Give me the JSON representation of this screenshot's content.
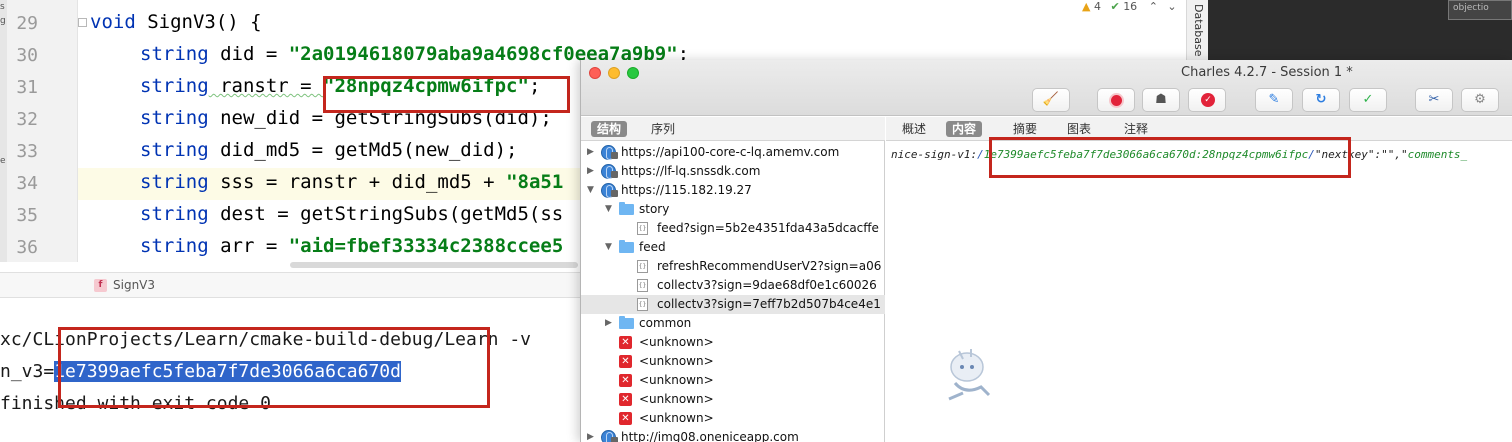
{
  "ide": {
    "edge_glyphs": [
      "s",
      "g",
      "e"
    ],
    "line_numbers": [
      "29",
      "30",
      "31",
      "32",
      "33",
      "34",
      "35",
      "36"
    ],
    "code": [
      {
        "kw": "void",
        "rest": " SignV3() {",
        "str": "",
        "tail": ""
      },
      {
        "kw": "string",
        "rest": " did = ",
        "str": "\"2a0194618079aba9a4698cf0eea7a9b9\"",
        "tail": ";"
      },
      {
        "kw": "string",
        "rest": " ranstr = ",
        "str": "\"28npqz4cpmw6ifpc\"",
        "tail": ";"
      },
      {
        "kw": "string",
        "rest": " new_did = getStringSubs(did);",
        "str": "",
        "tail": ""
      },
      {
        "kw": "string",
        "rest": " did_md5 = getMd5(new_did);",
        "str": "",
        "tail": ""
      },
      {
        "kw": "string",
        "rest": " sss = ranstr + did_md5 + ",
        "str": "\"8a51",
        "tail": ""
      },
      {
        "kw": "string",
        "rest": " dest = getStringSubs(getMd5(ss",
        "str": "",
        "tail": ""
      },
      {
        "kw": "string",
        "rest": " arr = ",
        "str": "\"aid=fbef33334c2388ccee5",
        "tail": ""
      }
    ],
    "inspections": {
      "warnings": "4",
      "checks": "16"
    },
    "database_tab": "Database",
    "dark_thumb_text": "objectio",
    "breadcrumb": {
      "badge": "f",
      "label": "SignV3"
    },
    "terminal": {
      "line1": "xc/CLionProjects/Learn/cmake-build-debug/Learn -v",
      "line2_prefix": "n_v3=",
      "line2_selected": "1e7399aefc5feba7f7de3066a6ca670d",
      "line3": "finished with exit code 0"
    }
  },
  "charles": {
    "title": "Charles 4.2.7 - Session 1 *",
    "left_tabs": [
      "结构",
      "序列"
    ],
    "right_tabs": [
      "概述",
      "内容",
      "摘要",
      "图表",
      "注释"
    ],
    "tree": [
      {
        "indent": 0,
        "arrow": "▶",
        "type": "globe",
        "label": "https://api100-core-c-lq.amemv.com"
      },
      {
        "indent": 0,
        "arrow": "▶",
        "type": "globe",
        "label": "https://lf-lq.snssdk.com"
      },
      {
        "indent": 0,
        "arrow": "▼",
        "type": "globe",
        "label": "https://115.182.19.27"
      },
      {
        "indent": 1,
        "arrow": "▼",
        "type": "folder",
        "label": "story"
      },
      {
        "indent": 2,
        "arrow": "",
        "type": "doc",
        "label": "feed?sign=5b2e4351fda43a5dcacffe"
      },
      {
        "indent": 1,
        "arrow": "▼",
        "type": "folder",
        "label": "feed"
      },
      {
        "indent": 2,
        "arrow": "",
        "type": "doc",
        "label": "refreshRecommendUserV2?sign=a06"
      },
      {
        "indent": 2,
        "arrow": "",
        "type": "doc",
        "label": "collectv3?sign=9dae68df0e1c60026"
      },
      {
        "indent": 2,
        "arrow": "",
        "type": "doc",
        "label": "collectv3?sign=7eff7b2d507b4ce4e1"
      },
      {
        "indent": 1,
        "arrow": "▶",
        "type": "folder",
        "label": "common"
      },
      {
        "indent": 1,
        "arrow": "",
        "type": "error",
        "label": "<unknown>"
      },
      {
        "indent": 1,
        "arrow": "",
        "type": "error",
        "label": "<unknown>"
      },
      {
        "indent": 1,
        "arrow": "",
        "type": "error",
        "label": "<unknown>"
      },
      {
        "indent": 1,
        "arrow": "",
        "type": "error",
        "label": "<unknown>"
      },
      {
        "indent": 1,
        "arrow": "",
        "type": "error",
        "label": "<unknown>"
      },
      {
        "indent": 0,
        "arrow": "▶",
        "type": "globe",
        "label": "http://img08.oneniceapp.com"
      }
    ],
    "selected_row": 8,
    "content": {
      "key": "nice-sign-v1:",
      "value": "1e7399aefc5feba7f7de3066a6ca670d:28npqz4cpmw6ifpc",
      "tail_a": "\"nextkey\":\"\",\"",
      "tail_b": "comments_"
    },
    "toolbar_icons": [
      "broom-icon",
      "record-icon",
      "throttle-icon",
      "breakpoint-icon",
      "compose-icon",
      "repeat-icon",
      "validate-icon",
      "tools-icon",
      "settings-icon"
    ]
  },
  "colors": {
    "annotation_red": "#c4261d",
    "selection_blue": "#2f65ca",
    "string_green": "#067d17",
    "keyword_blue": "#0033b3"
  }
}
